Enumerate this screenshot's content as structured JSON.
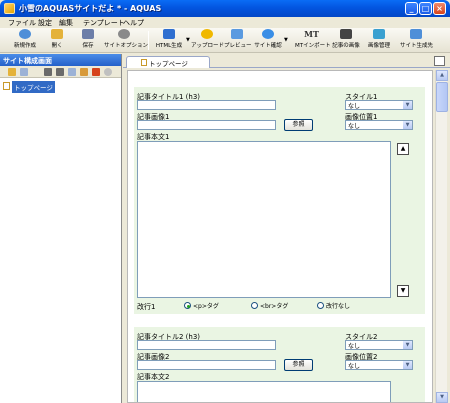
{
  "window": {
    "title": "小雪のAQUASサイトだよ * - AQUAS",
    "buttons": {
      "minimize": "_",
      "maximize": "□",
      "close": "×"
    }
  },
  "menu": [
    "ファイル",
    "設定",
    "編集",
    "テンプレート",
    "ヘルプ"
  ],
  "toolbar": {
    "items": [
      {
        "label": "新規作成",
        "icon": "new-site-icon",
        "color": "#4f8fd8"
      },
      {
        "label": "開く",
        "icon": "open-folder-icon",
        "color": "#e4b23a"
      },
      {
        "label": "保存",
        "icon": "save-icon",
        "color": "#6c7ea8"
      },
      {
        "label": "サイトオプション",
        "icon": "gear-icon",
        "color": "#8a8a8a"
      },
      {
        "label": "HTML生成",
        "icon": "html-generate-icon",
        "color": "#2f6fd0"
      },
      {
        "label": "アップロード",
        "icon": "upload-icon",
        "color": "#f0b800"
      },
      {
        "label": "プレビュー",
        "icon": "preview-icon",
        "color": "#5a9ae0"
      },
      {
        "label": "サイト確認",
        "icon": "globe-icon",
        "color": "#3a8ee6"
      },
      {
        "label": "MTインポート",
        "icon": "mt-icon",
        "color": "#333333"
      },
      {
        "label": "記事の画像",
        "icon": "binoculars-icon",
        "color": "#444444"
      },
      {
        "label": "画像管理",
        "icon": "image-manage-icon",
        "color": "#3aa0d0"
      },
      {
        "label": "サイト生成先",
        "icon": "folder-target-icon",
        "color": "#4f8fd8"
      }
    ],
    "mt_glyph": "MT"
  },
  "left_pane": {
    "header": "サイト構成画面",
    "tree": [
      {
        "label": "トップページ",
        "selected": true
      }
    ]
  },
  "right_pane": {
    "tab_label": "トップページ",
    "articles": [
      {
        "title_label": "記事タイトル1 (h3)",
        "style_label": "スタイル1",
        "style_value": "なし",
        "image_label": "記事画像1",
        "browse_label": "参照",
        "image_pos_label": "画像位置1",
        "image_pos_value": "なし",
        "body_label": "記事本文1",
        "linebreak_label": "改行1",
        "linebreak_options": [
          {
            "label": "<p>タグ",
            "selected": true
          },
          {
            "label": "<br>タグ",
            "selected": false
          },
          {
            "label": "改行なし",
            "selected": false
          }
        ],
        "up_glyph": "▲",
        "down_glyph": "▼"
      },
      {
        "title_label": "記事タイトル2 (h3)",
        "style_label": "スタイル2",
        "style_value": "なし",
        "image_label": "記事画像2",
        "browse_label": "参照",
        "image_pos_label": "画像位置2",
        "image_pos_value": "なし",
        "body_label": "記事本文2"
      }
    ]
  },
  "colors": {
    "titlebar": "#0355e0",
    "article_bg": "#eaf5e3",
    "selection": "#316ac5"
  }
}
